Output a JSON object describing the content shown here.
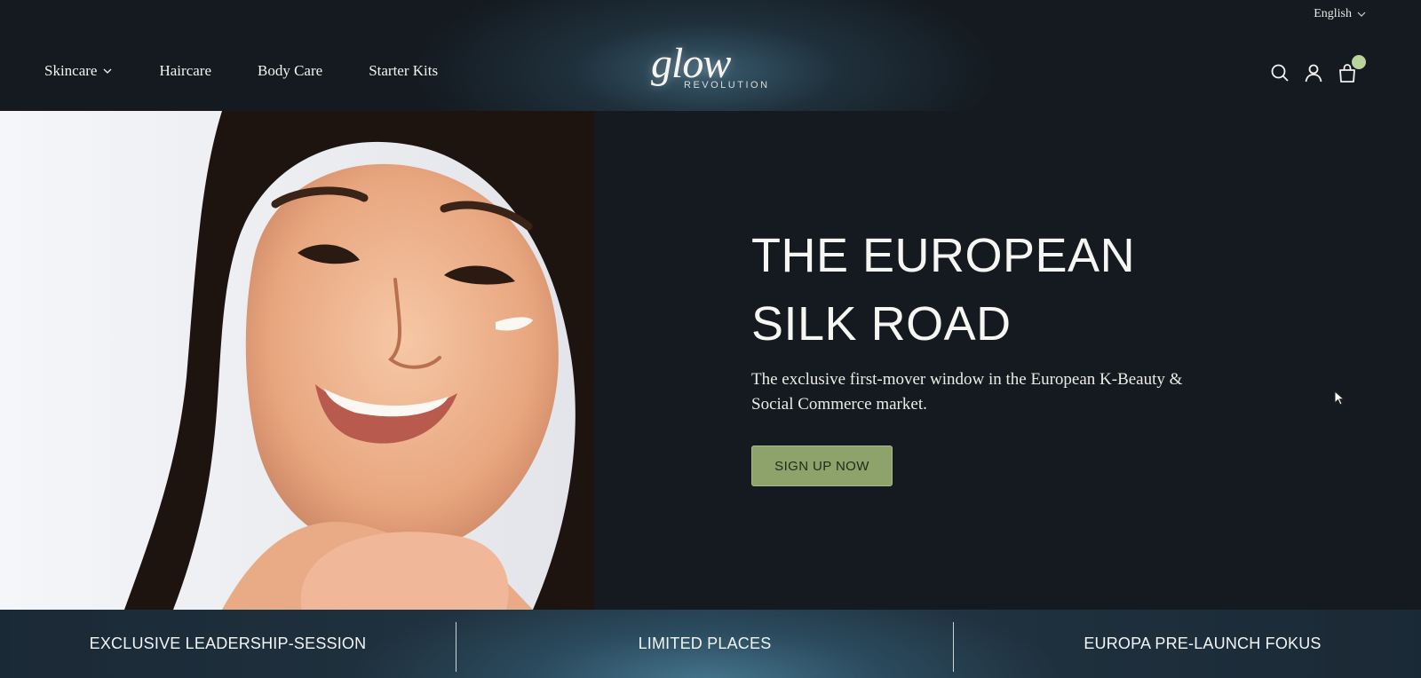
{
  "header": {
    "language": "English",
    "nav": [
      {
        "label": "Skincare",
        "has_dropdown": true
      },
      {
        "label": "Haircare",
        "has_dropdown": false
      },
      {
        "label": "Body Care",
        "has_dropdown": false
      },
      {
        "label": "Starter Kits",
        "has_dropdown": false
      }
    ],
    "logo": {
      "word": "glow",
      "sub": "REVOLUTION"
    },
    "icons": [
      "search-icon",
      "account-icon",
      "cart-icon"
    ]
  },
  "hero": {
    "title_line1": "THE EUROPEAN",
    "title_line2": "SILK ROAD",
    "subtitle": "The exclusive first-mover window in the European K-Beauty & Social Commerce market.",
    "cta": "SIGN UP NOW",
    "image_desc": "smiling woman with cream on cheek"
  },
  "strip": {
    "items": [
      "EXCLUSIVE LEADERSHIP-SESSION",
      "LIMITED PLACES",
      "EUROPA PRE-LAUNCH FOKUS"
    ]
  },
  "colors": {
    "background": "#141a20",
    "accent_button": "#8ea36c",
    "cart_badge": "#b9d39a"
  }
}
